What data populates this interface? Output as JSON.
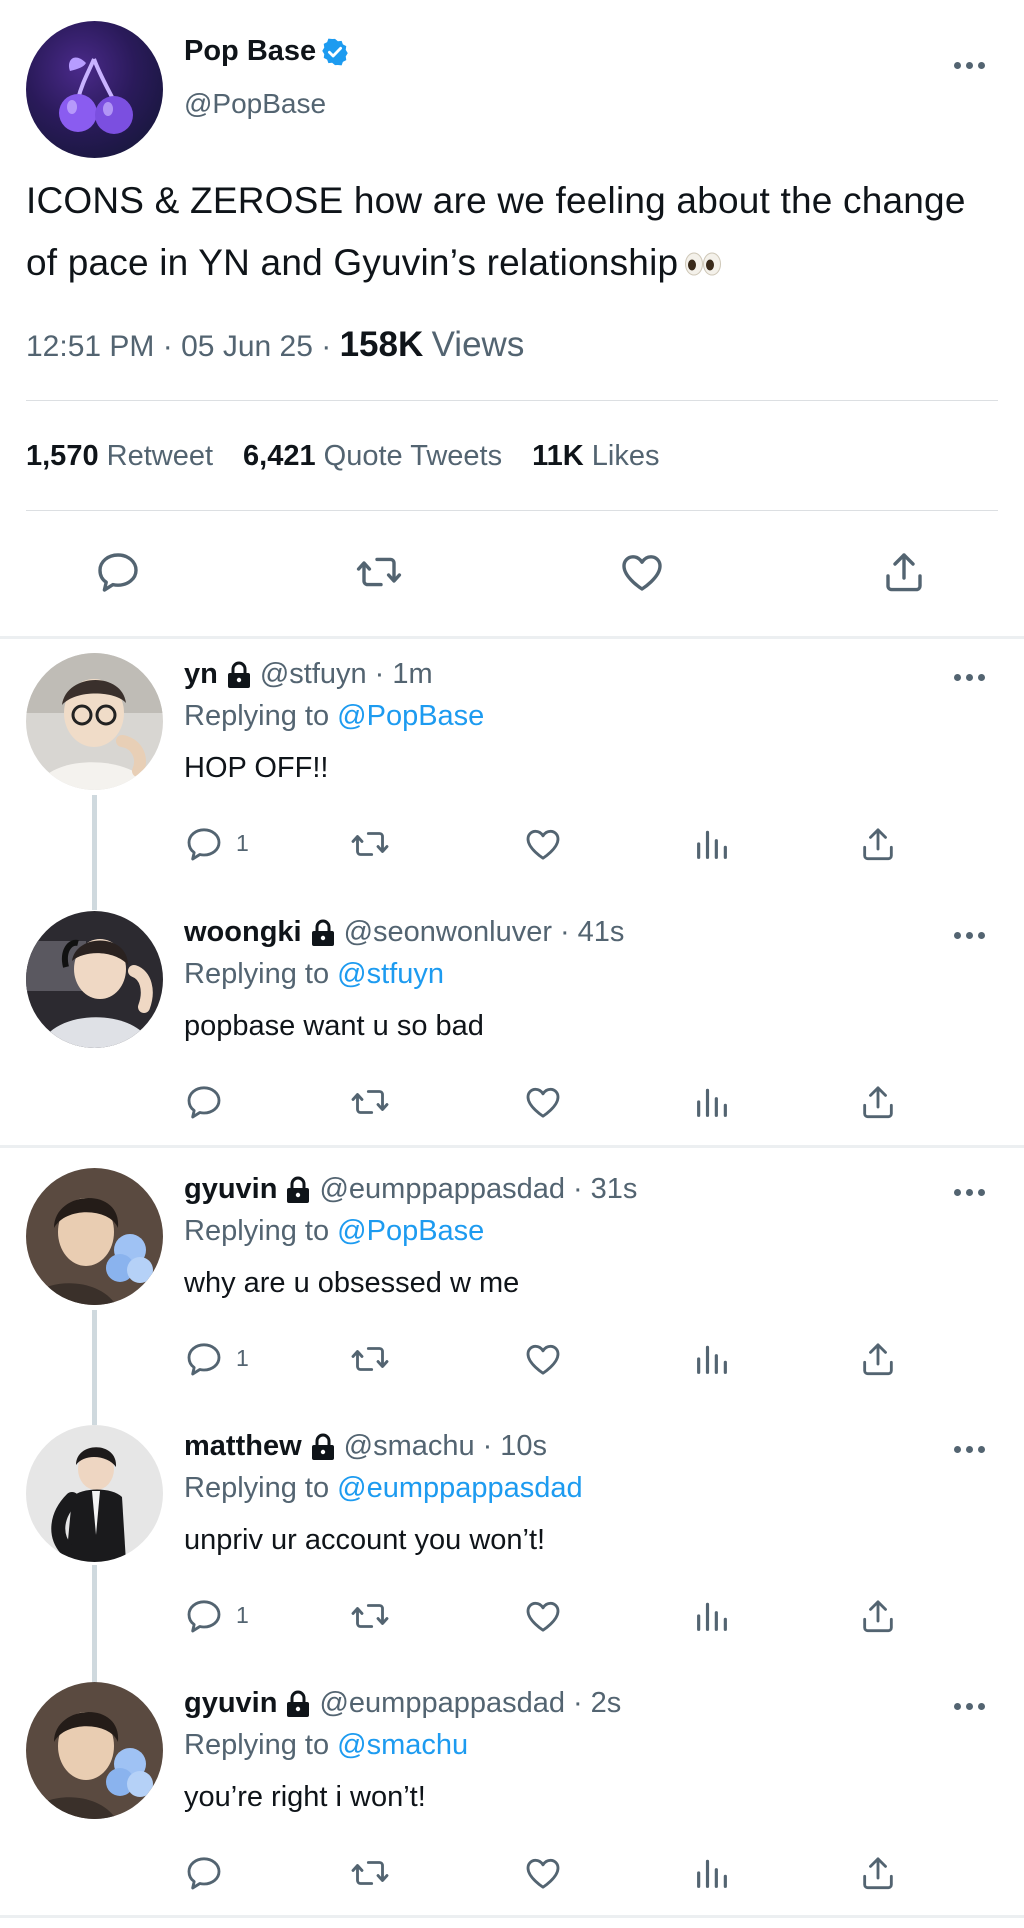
{
  "main_tweet": {
    "author_name": "Pop Base",
    "author_handle": "@PopBase",
    "text": "ICONS & ZEROSE how are we feeling about the change of pace in YN and Gyuvin’s relationship",
    "time": "12:51 PM",
    "date": "05 Jun 25",
    "views_count": "158K",
    "views_label": "Views",
    "stats": {
      "retweets_count": "1,570",
      "retweets_label": "Retweet",
      "quotes_count": "6,421",
      "quotes_label": "Quote Tweets",
      "likes_count": "11K",
      "likes_label": "Likes"
    },
    "icons": [
      "verified-badge-icon",
      "more-icon",
      "eyes-emoji-icon",
      "reply-icon",
      "retweet-icon",
      "like-icon",
      "share-icon"
    ],
    "colors": {
      "verified": "#1d9bf0",
      "text": "#0f1419",
      "secondary": "#536471"
    }
  },
  "replies": [
    {
      "name": "yn",
      "handle": "@stfuyn",
      "time": "1m",
      "replying_label": "Replying to",
      "replying_to": "@PopBase",
      "text": "HOP OFF!!",
      "reply_count": "1"
    },
    {
      "name": "woongki",
      "handle": "@seonwonluver",
      "time": "41s",
      "replying_label": "Replying to",
      "replying_to": "@stfuyn",
      "text": "popbase want u so bad",
      "reply_count": ""
    },
    {
      "name": "gyuvin",
      "handle": "@eumppappasdad",
      "time": "31s",
      "replying_label": "Replying to",
      "replying_to": "@PopBase",
      "text": "why are u obsessed w me",
      "reply_count": "1"
    },
    {
      "name": "matthew",
      "handle": "@smachu",
      "time": "10s",
      "replying_label": "Replying to",
      "replying_to": "@eumppappasdad",
      "text": "unpriv ur account you won’t!",
      "reply_count": "1"
    },
    {
      "name": "gyuvin",
      "handle": "@eumppappasdad",
      "time": "2s",
      "replying_label": "Replying to",
      "replying_to": "@smachu",
      "text": "you’re right i won’t!",
      "reply_count": ""
    }
  ],
  "separator": "·",
  "mention_color": "#1d9bf0"
}
